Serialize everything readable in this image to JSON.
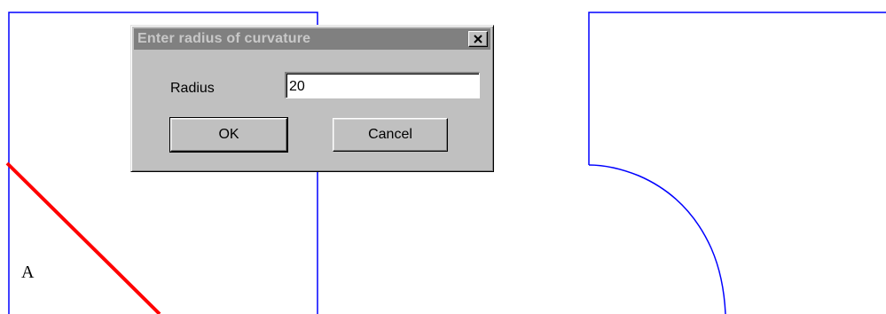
{
  "dialog": {
    "title": "Enter radius of curvature",
    "close_icon": "close-icon",
    "radius_label": "Radius",
    "radius_value": "20",
    "ok_label": "OK",
    "cancel_label": "Cancel"
  },
  "drawing": {
    "point_label": "A",
    "outline_color": "#0000ff",
    "selected_edge_color": "#ff0000"
  }
}
